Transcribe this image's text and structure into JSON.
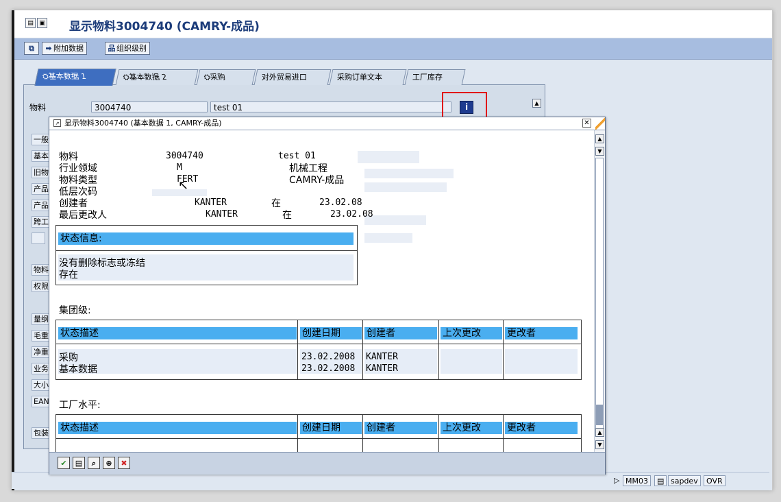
{
  "window": {
    "title": "显示物料3004740 (CAMRY-成品)"
  },
  "toolbar": {
    "additional_data": "附加数据",
    "org_levels": "组织级别"
  },
  "tabs": [
    {
      "label": "基本数据 1",
      "active": true
    },
    {
      "label": "基本数据 2",
      "active": false
    },
    {
      "label": "采购",
      "active": false
    },
    {
      "label": "对外贸易进口",
      "active": false
    },
    {
      "label": "采购订单文本",
      "active": false
    },
    {
      "label": "工厂库存",
      "active": false
    }
  ],
  "material_row": {
    "label": "物料",
    "number": "3004740",
    "description": "test 01"
  },
  "left_labels": [
    "一般",
    "基本",
    "旧物",
    "产品",
    "产品",
    "跨工",
    "物料",
    "权限",
    "量纲",
    "毛重",
    "净重",
    "业务",
    "大小",
    "EAN",
    "包装"
  ],
  "dialog": {
    "title": "显示物料3004740 (基本数据 1, CAMRY-成品)",
    "material_label": "物料",
    "material_number": "3004740",
    "material_desc": "test 01",
    "industry_label": "行业领域",
    "industry_code": "M",
    "industry_text": "机械工程",
    "type_label": "物料类型",
    "type_code": "FERT",
    "type_text": "CAMRY-成品",
    "low_level_label": "低层次码",
    "created_by_label": "创建者",
    "created_by": "KANTER",
    "created_at_word": "在",
    "created_date": "23.02.08",
    "changed_by_label": "最后更改人",
    "changed_by": "KANTER",
    "changed_at_word": "在",
    "changed_date": "23.02.08",
    "status_info_header": "状态信息:",
    "status_line1": "没有删除标志或冻结",
    "status_line2": "存在",
    "group_level_label": "集团级:",
    "plant_level_label": "工厂水平:",
    "table_headers": [
      "状态描述",
      "创建日期",
      "创建者",
      "上次更改",
      "更改者"
    ],
    "group_rows": [
      {
        "desc": "采购",
        "created": "23.02.2008",
        "creator": "KANTER",
        "last_change": "",
        "changer": ""
      },
      {
        "desc": "基本数据",
        "created": "23.02.2008",
        "creator": "KANTER",
        "last_change": "",
        "changer": ""
      }
    ]
  },
  "status_bar": {
    "transaction": "MM03",
    "system": "sapdev",
    "mode": "OVR"
  }
}
